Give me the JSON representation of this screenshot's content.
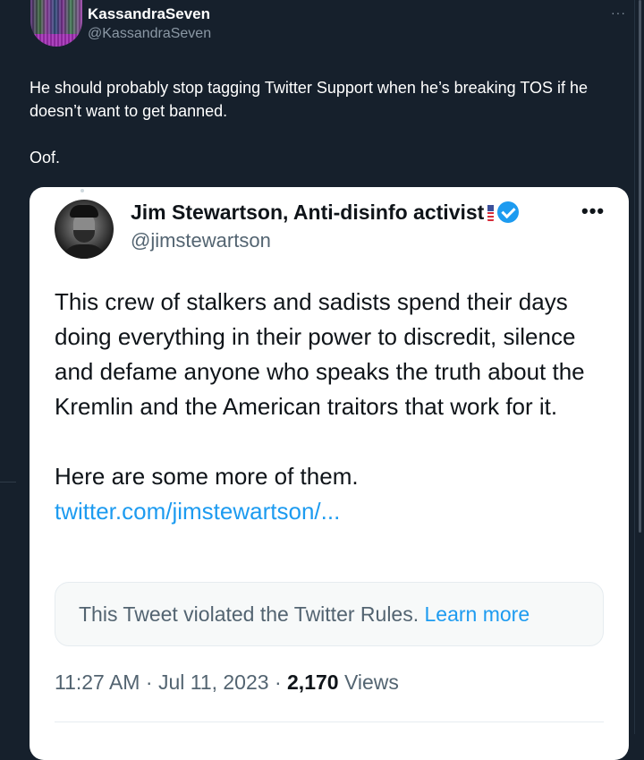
{
  "tweet": {
    "author_name": "KassandraSeven",
    "author_handle": "@KassandraSeven",
    "more": "···",
    "text_line1": "He should probably stop tagging Twitter Support when he’s breaking TOS if he doesn’t want to get banned.",
    "text_line2": "Oof."
  },
  "quoted": {
    "name": "Jim Stewartson, Anti-disinfo activist",
    "handle": "@jimstewartson",
    "more": "•••",
    "body_p1": "This crew of stalkers and sadists spend their days doing everything in their power to discredit, silence and defame anyone who speaks the truth about the Kremlin and the American traitors that work for it.",
    "body_p2": "Here are some more of them.",
    "link": "twitter.com/jimstewartson/...",
    "violation_text": "This Tweet violated the Twitter Rules.",
    "learn_more": "Learn more",
    "time": "11:27 AM",
    "sep1": "·",
    "date": "Jul 11, 2023",
    "sep2": "·",
    "views_count": "2,170",
    "views_label": "Views"
  },
  "colors": {
    "background": "#16202c",
    "card": "#ffffff",
    "link": "#1d9bf0",
    "muted": "#536471"
  }
}
